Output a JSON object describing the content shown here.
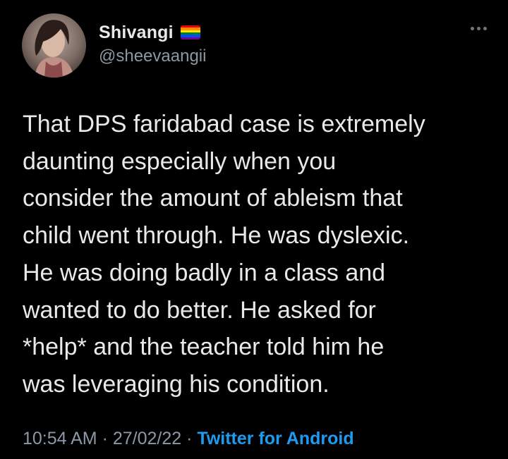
{
  "author": {
    "display_name": "Shivangi",
    "handle": "@sheevaangii",
    "avatar_icon": "profile-photo",
    "badge_icon": "rainbow-flag-icon"
  },
  "menu": {
    "more_icon": "more-options-icon"
  },
  "tweet": {
    "lines": [
      "That DPS faridabad case is extremely",
      "daunting especially when you",
      "consider the amount of ableism that",
      "child went through. He was dyslexic.",
      "He was doing badly in a class and",
      "wanted to do better. He asked for",
      "*help* and the teacher told him he",
      "was leveraging his condition."
    ]
  },
  "meta": {
    "time": "10:54 AM",
    "separator": " · ",
    "date": "27/02/22",
    "source": "Twitter for Android"
  },
  "colors": {
    "background": "#000000",
    "text": "#e7e9ea",
    "secondary": "#8b98a5",
    "link": "#1d9bf0",
    "flag_stripes": [
      "#e40303",
      "#ff8c00",
      "#ffed00",
      "#008026",
      "#004dff",
      "#750787"
    ]
  }
}
